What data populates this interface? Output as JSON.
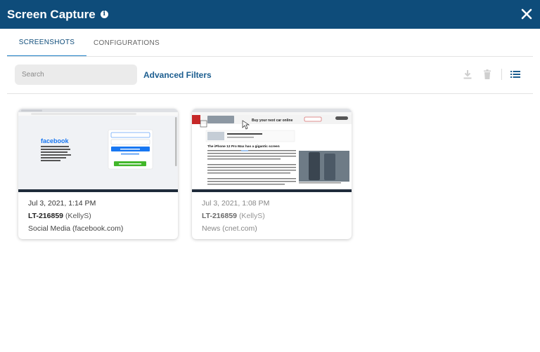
{
  "header": {
    "title": "Screen Capture",
    "bg_color": "#0e4c7a"
  },
  "tabs": [
    {
      "label": "SCREENSHOTS",
      "active": true
    },
    {
      "label": "CONFIGURATIONS",
      "active": false
    }
  ],
  "toolbar": {
    "search_placeholder": "Search",
    "advanced_filters_label": "Advanced Filters",
    "icons": [
      "download-icon",
      "delete-icon",
      "list-view-icon"
    ]
  },
  "cards": [
    {
      "date": "Jul 3, 2021, 1:14 PM",
      "user_id": "LT-216859",
      "user_name": "(KellyS)",
      "category": "Social Media (facebook.com)",
      "thumbnail": {
        "site": "facebook",
        "logo_text": "facebook"
      }
    },
    {
      "date": "Jul 3, 2021, 1:08 PM",
      "user_id": "LT-216859",
      "user_name": "(KellyS)",
      "category": "News (cnet.com)",
      "thumbnail": {
        "site": "cnet",
        "ad_text": "Buy your next car online",
        "headline": "The iPhone 12 Pro Max has a gigantic screen"
      }
    }
  ]
}
